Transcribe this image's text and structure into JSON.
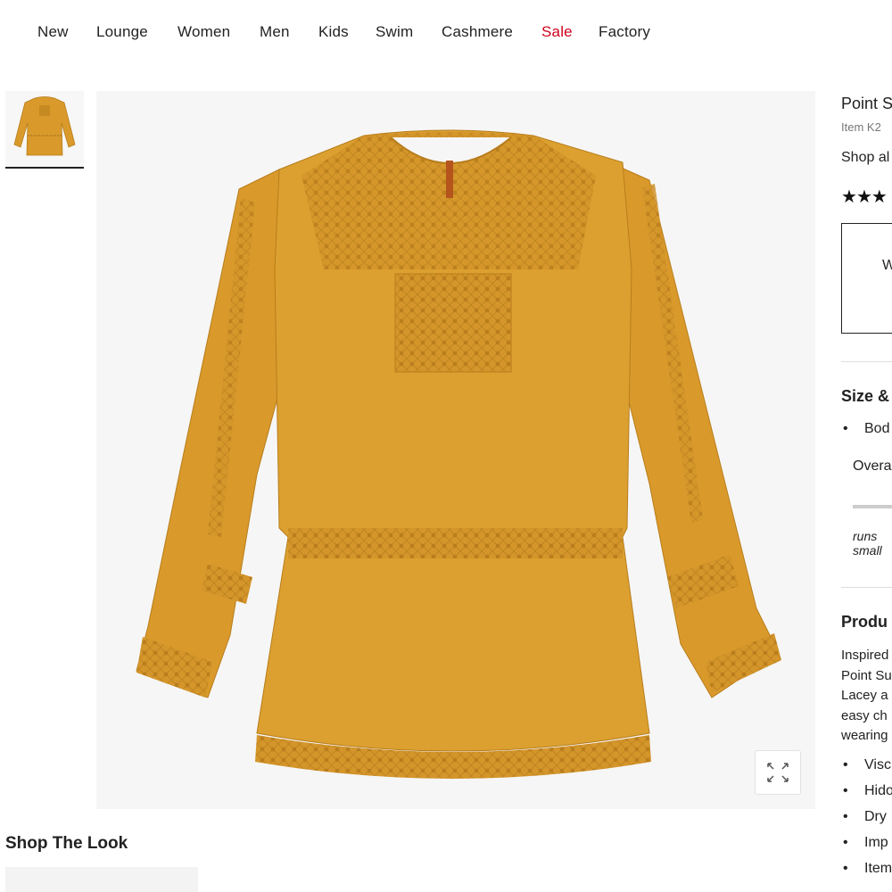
{
  "nav": {
    "items": [
      {
        "label": "New"
      },
      {
        "label": "Lounge"
      },
      {
        "label": "Women"
      },
      {
        "label": "Men"
      },
      {
        "label": "Kids"
      },
      {
        "label": "Swim"
      },
      {
        "label": "Cashmere"
      },
      {
        "label": "Sale"
      },
      {
        "label": "Factory"
      }
    ],
    "sale_color": "#d0021b"
  },
  "product": {
    "name_visible": "Point S",
    "item_visible": "Item K2",
    "shop_all_visible": "Shop al",
    "rating_stars_visible": 3,
    "promo_visible": "W",
    "expand_icon": "expand-icon",
    "image_color": "#d99a2b"
  },
  "size_fit": {
    "heading_visible": "Size &",
    "bullet_visible": "Bod",
    "overall_visible": "Overa",
    "fit_label_line1": "runs",
    "fit_label_line2": "small"
  },
  "details": {
    "heading_visible": "Produ",
    "description_lines": [
      "Inspired",
      "Point Su",
      "Lacey a",
      "easy ch",
      "wearing"
    ],
    "bullets": [
      "Visc",
      "Hido",
      "Dry",
      "Imp",
      "Item"
    ]
  },
  "shop_the_look": {
    "heading": "Shop The Look"
  }
}
